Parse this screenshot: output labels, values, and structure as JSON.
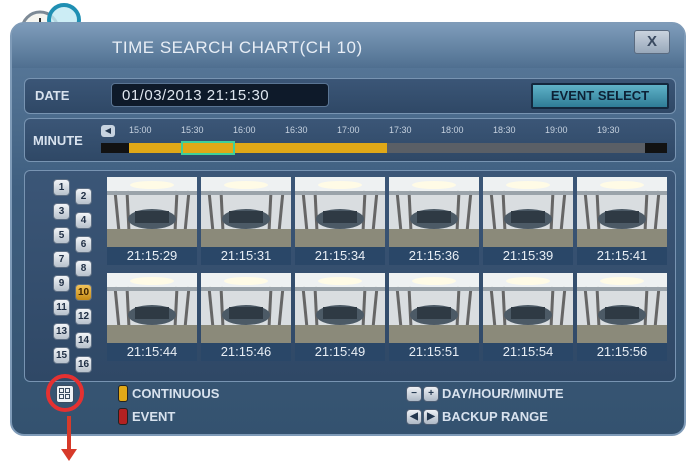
{
  "window": {
    "title": "TIME SEARCH CHART(CH 10)",
    "close_label": "X"
  },
  "date_row": {
    "label": "DATE",
    "value": "01/03/2013 21:15:30",
    "event_select_label": "EVENT SELECT"
  },
  "minute_row": {
    "label": "MINUTE",
    "ticks": [
      "15:00",
      "15:30",
      "16:00",
      "16:30",
      "17:00",
      "17:30",
      "18:00",
      "18:30",
      "19:00",
      "19:30"
    ]
  },
  "channels": [
    "1",
    "2",
    "3",
    "4",
    "5",
    "6",
    "7",
    "8",
    "9",
    "10",
    "11",
    "12",
    "13",
    "14",
    "15",
    "16"
  ],
  "active_channel": "10",
  "thumbnails": [
    "21:15:29",
    "21:15:31",
    "21:15:34",
    "21:15:36",
    "21:15:39",
    "21:15:41",
    "21:15:44",
    "21:15:46",
    "21:15:49",
    "21:15:51",
    "21:15:54",
    "21:15:56"
  ],
  "legend": {
    "continuous": "CONTINUOUS",
    "event": "EVENT",
    "day_hour_minute": "DAY/HOUR/MINUTE",
    "backup_range": "BACKUP RANGE"
  },
  "colors": {
    "continuous": "#e0a817",
    "event": "#b32121",
    "accent": "#3f8aa8",
    "highlight": "#e53131"
  }
}
